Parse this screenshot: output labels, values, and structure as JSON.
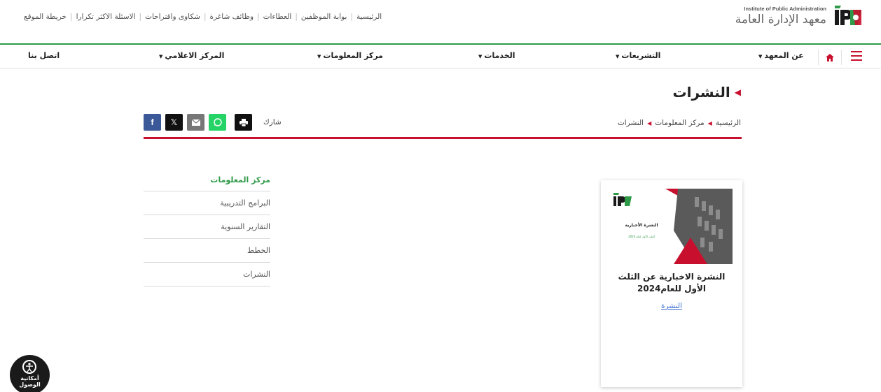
{
  "header": {
    "brand_en": "Institute of Public Administration",
    "brand_ar": "معهد الإدارة العامة",
    "top_links": [
      "الرئيسية",
      "بوابة الموظفين",
      "العطاءات",
      "وظائف شاغرة",
      "شكاوى واقتراحات",
      "الاسئلة الاكثر تكرارا",
      "خريطة الموقع"
    ]
  },
  "nav": {
    "about": "عن المعهد",
    "legislation": "التشريعات",
    "services": "الخدمات",
    "info_center": "مركز المعلومات",
    "media_center": "المركز الاعلامي",
    "contact": "اتصل بنا"
  },
  "page": {
    "title": "النشرات",
    "breadcrumb": [
      "الرئيسية",
      "مركز المعلومات",
      "النشرات"
    ],
    "share_label": "شارك"
  },
  "sidebar": {
    "title": "مركز المعلومات",
    "items": [
      "البرامج التدريبية",
      "التقارير السنوية",
      "الخطط",
      "النشرات"
    ]
  },
  "card": {
    "thumb_title": "النشرة الأخبارية",
    "thumb_subtitle": "الثلث الأول لعام 2024",
    "title": "النشرة الاخبارية عن الثلث الأول للعام2024",
    "link": "النشرة"
  },
  "accessibility": {
    "label_line1": "أمكانية",
    "label_line2": "الوصول"
  },
  "colors": {
    "accent_red": "#c8102e",
    "accent_green": "#2e9a48",
    "link_blue": "#3a6fd1"
  }
}
